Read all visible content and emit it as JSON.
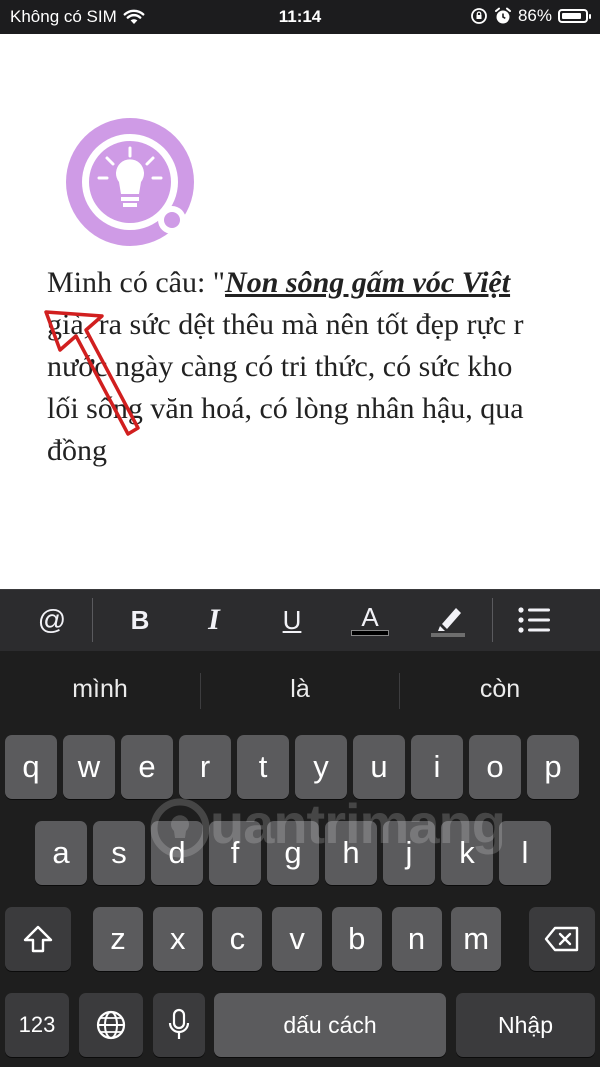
{
  "status_bar": {
    "carrier": "Không có SIM",
    "time": "11:14",
    "battery": "86%",
    "battery_level": 0.86
  },
  "document": {
    "line1_prefix": "Minh có câu: \"",
    "line1_title": "Non sông gấm vóc Việt",
    "line2": "già, ra sức dệt thêu mà nên tốt đẹp rực r",
    "line3": "nước ngày càng có tri thức, có sức kho",
    "line4": "lối sống văn hoá, có lòng nhân hậu, qua",
    "line5": "đồng"
  },
  "toolbar": {
    "mention": "@",
    "bold": "B",
    "italic": "I",
    "underline": "U",
    "text_color": "A"
  },
  "colors": {
    "logo_purple": "#cf9be6",
    "arrow_red": "#d11f1f",
    "keyboard_bg": "#1e1e1e",
    "key": "#5b5b5d",
    "key_dark": "#3b3b3d"
  },
  "keyboard": {
    "suggestions": [
      "mình",
      "là",
      "còn"
    ],
    "row1": [
      "q",
      "w",
      "e",
      "r",
      "t",
      "y",
      "u",
      "i",
      "o",
      "p"
    ],
    "row2": [
      "a",
      "s",
      "d",
      "f",
      "g",
      "h",
      "j",
      "k",
      "l"
    ],
    "row3": [
      "z",
      "x",
      "c",
      "v",
      "b",
      "n",
      "m"
    ],
    "numbers_key": "123",
    "space_key": "dấu cách",
    "return_key": "Nhập"
  },
  "watermark": "uantrimang"
}
